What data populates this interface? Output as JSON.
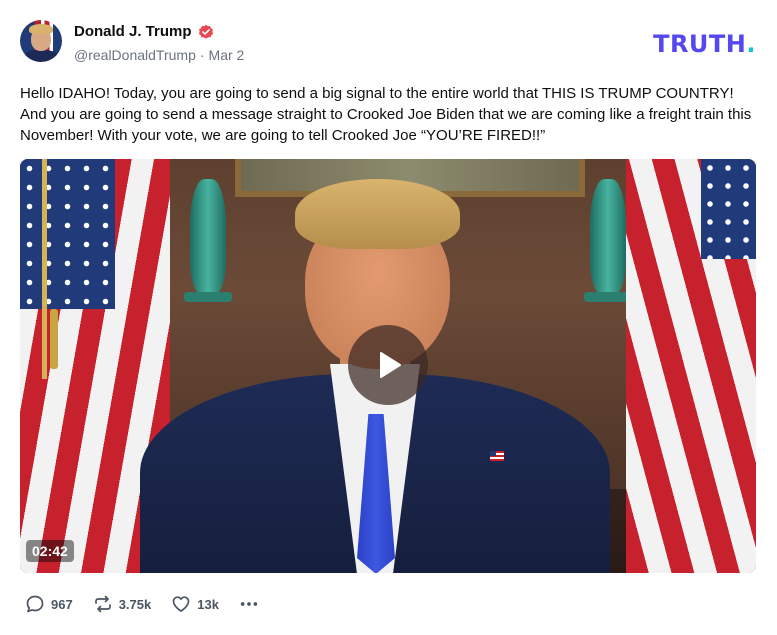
{
  "author": {
    "display_name": "Donald J. Trump",
    "handle": "@realDonaldTrump",
    "separator": "·",
    "date": "Mar 2",
    "verified": true
  },
  "brand": {
    "name": "TRUTH",
    "dot": ".",
    "color": "#5448ee",
    "dot_color": "#18c5c7"
  },
  "post": {
    "text": "Hello IDAHO! Today, you are going to send a big signal to the entire world that THIS IS TRUMP COUNTRY! And you are going to send a message straight to Crooked Joe Biden that we are coming like a freight train this November! With your vote, we are going to tell Crooked Joe “YOU’RE FIRED!!”"
  },
  "video": {
    "duration": "02:42",
    "play_icon": "play-icon"
  },
  "actions": {
    "replies": {
      "icon": "reply-icon",
      "count": "967"
    },
    "retruths": {
      "icon": "retruth-icon",
      "count": "3.75k"
    },
    "likes": {
      "icon": "heart-icon",
      "count": "13k"
    },
    "more": {
      "icon": "more-options-icon"
    }
  }
}
